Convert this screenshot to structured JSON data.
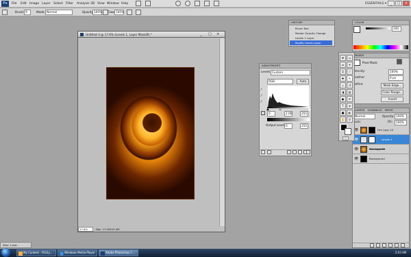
{
  "app": {
    "logo": "Ps",
    "menus": [
      "File",
      "Edit",
      "Image",
      "Layer",
      "Select",
      "Filter",
      "Analysis",
      "3D",
      "View",
      "Window",
      "Help"
    ],
    "workspace": "ESSENTIALS ▾",
    "window_controls": [
      "_",
      "□",
      "×"
    ]
  },
  "options_bar": {
    "brush_label": "Brush:",
    "brush_size": "9",
    "mode_label": "Mode:",
    "mode_value": "Normal",
    "opacity_label": "Opacity:",
    "opacity_value": "100%",
    "flow_label": "Flow:",
    "flow_value": "100%"
  },
  "document": {
    "title": "Untitled-3 @ 17.6% (Levels 1, Layer Mask/8) *",
    "zoom": "17.6%",
    "doc_size": "Doc: 17.2M/15.4M"
  },
  "history": {
    "tab": "HISTORY",
    "items": [
      {
        "label": "Brush Tool",
        "active": false
      },
      {
        "label": "Master Opacity Change",
        "active": false
      },
      {
        "label": "Levels 1 Layer",
        "active": false
      },
      {
        "label": "Modify Levels Layer",
        "active": true
      }
    ]
  },
  "color_panel": {
    "tabs": [
      "COLOR",
      "SWATCHES",
      "STYLES"
    ],
    "value": "100",
    "palette": [
      "#ff0000",
      "#ff8000",
      "#ffff00",
      "#00ff00",
      "#00ffff",
      "#0000ff",
      "#ff00ff",
      "#ffffff",
      "#000000",
      "#888888"
    ]
  },
  "masks": {
    "tab": "MASKS",
    "mask_type": "Pixel Mask",
    "density_label": "Density:",
    "density_value": "100%",
    "feather_label": "Feather:",
    "feather_value": "0 px",
    "refine_label": "Refine:",
    "buttons": [
      "Mask Edge...",
      "Color Range...",
      "Invert"
    ]
  },
  "adjustments": {
    "tab": "ADJUSTMENTS",
    "levels_label": "Levels",
    "preset_value": "Custom",
    "channel_value": "RGB",
    "auto_button": "Auto",
    "input_values": [
      "0",
      "2.06",
      "255"
    ],
    "output_label": "Output Levels:",
    "output_values": [
      "0",
      "255"
    ]
  },
  "layers": {
    "tabs": [
      "LAYERS",
      "CHANNELS",
      "PATHS"
    ],
    "blend_mode": "Normal",
    "opacity_label": "Opacity:",
    "opacity_value": "100%",
    "lock_label": "Lock:",
    "fill_label": "Fill:",
    "fill_value": "100%",
    "rows": [
      {
        "name": "Fire copy 10",
        "selected": false,
        "strike": false
      },
      {
        "name": "Levels 1",
        "selected": true,
        "strike": false
      },
      {
        "name": "Fire copy 11",
        "selected": false,
        "strike": true
      },
      {
        "name": "Background",
        "selected": false,
        "strike": false
      }
    ]
  },
  "minimized_doc": "Step 1.psd...",
  "taskbar": {
    "tasks": [
      {
        "label": "My Content - FELEy...",
        "active": false
      },
      {
        "label": "Windows Media Player",
        "active": false
      },
      {
        "label": "Adobe Photoshop C...",
        "active": true
      }
    ],
    "clock": "2:03 AM"
  },
  "colors": {
    "accent": "#3a6ed6",
    "taskbar": "#1f3553",
    "workspace_bg": "#a3a3a3"
  }
}
